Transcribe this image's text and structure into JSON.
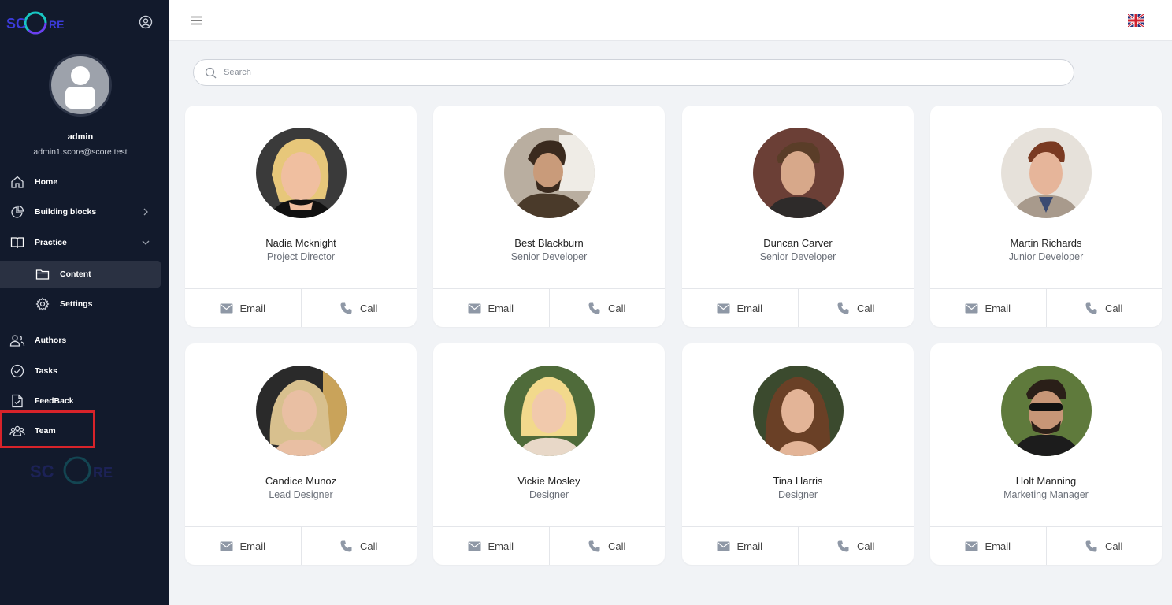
{
  "app": {
    "logo_text": "SCORE"
  },
  "user": {
    "name": "admin",
    "email": "admin1.score@score.test"
  },
  "nav": {
    "home": "Home",
    "building_blocks": "Building blocks",
    "practice": "Practice",
    "content": "Content",
    "settings": "Settings",
    "authors": "Authors",
    "tasks": "Tasks",
    "feedback": "FeedBack",
    "team": "Team"
  },
  "search": {
    "placeholder": "Search"
  },
  "actions": {
    "email": "Email",
    "call": "Call"
  },
  "team": [
    {
      "name": "Nadia Mcknight",
      "role": "Project Director"
    },
    {
      "name": "Best Blackburn",
      "role": "Senior Developer"
    },
    {
      "name": "Duncan Carver",
      "role": "Senior Developer"
    },
    {
      "name": "Martin Richards",
      "role": "Junior Developer"
    },
    {
      "name": "Candice Munoz",
      "role": "Lead Designer"
    },
    {
      "name": "Vickie Mosley",
      "role": "Designer"
    },
    {
      "name": "Tina Harris",
      "role": "Designer"
    },
    {
      "name": "Holt Manning",
      "role": "Marketing Manager"
    }
  ],
  "colors": {
    "sidebar_bg": "#121a2c",
    "active_bg": "#2a3142",
    "highlight": "#d8232a",
    "page_bg": "#f1f3f6"
  }
}
